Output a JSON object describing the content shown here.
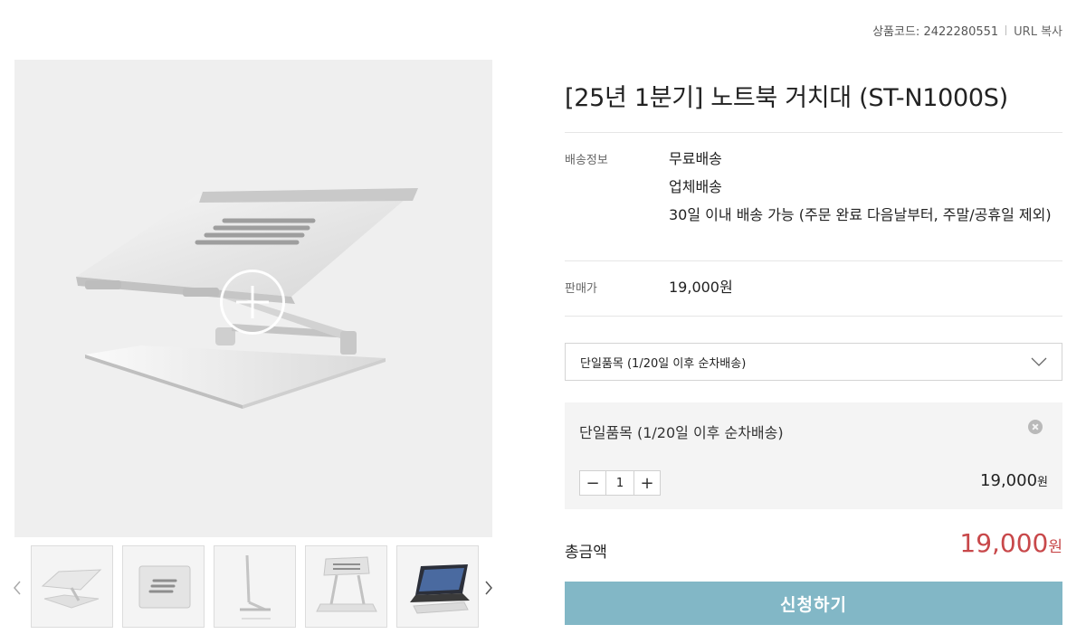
{
  "product_code": {
    "label": "상품코드: 2422280551",
    "copy_url": "URL 복사"
  },
  "title": "[25년 1분기] 노트북 거치대 (ST-N1000S)",
  "delivery": {
    "label": "배송정보",
    "lines": [
      "무료배송",
      "업체배송",
      "30일 이내 배송 가능 (주문 완료 다음날부터, 주말/공휴일 제외)"
    ]
  },
  "price": {
    "label": "판매가",
    "value": "19,000원"
  },
  "option_select": {
    "selected": "단일품목 (1/20일 이후 순차배송)"
  },
  "selected_item": {
    "name": "단일품목 (1/20일 이후 순차배송)",
    "quantity": "1",
    "price": "19,000",
    "currency": "원"
  },
  "total": {
    "label": "총금액",
    "price": "19,000",
    "currency": "원"
  },
  "apply_button": "신청하기",
  "colors": {
    "accent": "#82b7c6",
    "price": "#c8484a"
  },
  "icons": [
    "zoom-plus-icon",
    "chevron-down-icon",
    "close-icon",
    "minus-icon",
    "plus-icon",
    "chevron-left-icon",
    "chevron-right-icon"
  ]
}
